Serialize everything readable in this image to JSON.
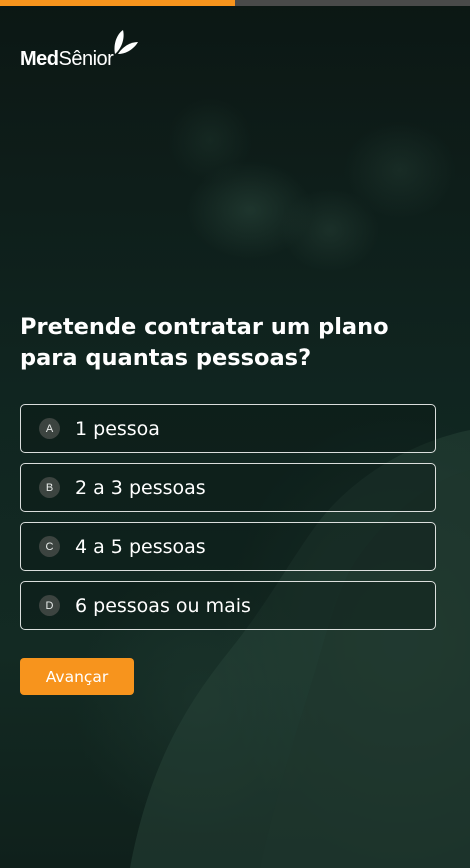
{
  "progress": {
    "fraction": 0.5,
    "fill_color": "#f7941d",
    "track_color": "#4a4a4a"
  },
  "brand": {
    "name_bold": "Med",
    "name_light": "Sênior",
    "icon": "leaf-icon"
  },
  "question": {
    "text": "Pretende contratar um plano para quantas pessoas?"
  },
  "options": [
    {
      "key": "A",
      "label": "1 pessoa"
    },
    {
      "key": "B",
      "label": "2 a 3 pessoas"
    },
    {
      "key": "C",
      "label": "4 a 5 pessoas"
    },
    {
      "key": "D",
      "label": "6 pessoas ou mais"
    }
  ],
  "actions": {
    "next_label": "Avançar",
    "accent": "#f7941d"
  }
}
